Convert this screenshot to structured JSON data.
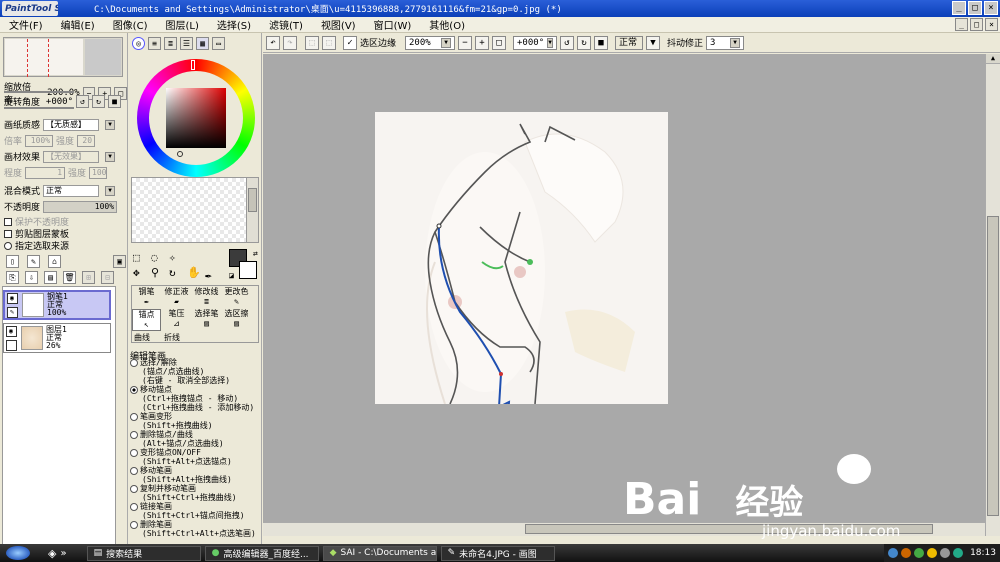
{
  "titlebar": {
    "logo": "PaintTool SAI",
    "title": "C:\\Documents and Settings\\Administrator\\桌面\\u=4115396888,2779161116&fm=21&gp=0.jpg (*)",
    "min": "_",
    "max": "□",
    "close": "×"
  },
  "menu": [
    "文件(F)",
    "编辑(E)",
    "图像(C)",
    "图层(L)",
    "选择(S)",
    "滤镜(T)",
    "视图(V)",
    "窗口(W)",
    "其他(O)"
  ],
  "navigator": {
    "zoom_label": "缩放倍率",
    "zoom_value": "200.0%",
    "rotate_label": "旋转角度",
    "rotate_value": "+000°"
  },
  "paper": {
    "texture_label": "画纸质感",
    "texture_value": "【无质感】",
    "rate_label": "倍率",
    "rate_value": "100%",
    "strength_label": "强度",
    "strength_value": "20",
    "effect_label": "画材效果",
    "effect_value": "【无效果】",
    "degree_label": "程度",
    "degree_value": "1",
    "strength2_label": "强度",
    "strength2_value": "100"
  },
  "layer_props": {
    "blend_label": "混合模式",
    "blend_value": "正常",
    "opacity_label": "不透明度",
    "opacity_value": "100%",
    "protect": "保护不透明度",
    "clip": "剪贴图层蒙板",
    "source": "指定选取来源"
  },
  "layers": [
    {
      "name": "钢笔1",
      "mode": "正常",
      "opacity": "100%"
    },
    {
      "name": "图层1",
      "mode": "正常",
      "opacity": "26%"
    }
  ],
  "tools": [
    {
      "label": "钢笔",
      "sub": ""
    },
    {
      "label": "修正液",
      "sub": ""
    },
    {
      "label": "修改线",
      "sub": ""
    },
    {
      "label": "更改色",
      "sub": ""
    },
    {
      "label": "锚点",
      "sub": "曲线"
    },
    {
      "label": "笔压",
      "sub": "折线"
    },
    {
      "label": "选择笔",
      "sub": ""
    },
    {
      "label": "选区擦",
      "sub": ""
    }
  ],
  "edit_options": {
    "header": "编辑笔画",
    "items": [
      {
        "label": "选择/解除",
        "hint": "(锚点/点选曲线)\n(右键 - 取消全部选择)",
        "on": false
      },
      {
        "label": "移动锚点",
        "hint": "(Ctrl+拖拽锚点 - 移动)\n(Ctrl+拖拽曲线 - 添加移动)",
        "on": true
      },
      {
        "label": "笔画变形",
        "hint": "(Shift+拖拽曲线)",
        "on": false
      },
      {
        "label": "删除锚点/曲线",
        "hint": "(Alt+锚点/点选曲线)",
        "on": false
      },
      {
        "label": "变形锚点ON/OFF",
        "hint": "(Shift+Alt+点选锚点)",
        "on": false
      },
      {
        "label": "移动笔画",
        "hint": "(Shift+Alt+拖拽曲线)",
        "on": false
      },
      {
        "label": "复制并移动笔画",
        "hint": "(Shift+Ctrl+拖拽曲线)",
        "on": false
      },
      {
        "label": "链接笔画",
        "hint": "(Shift+Ctrl+锚点间拖拽)",
        "on": false
      },
      {
        "label": "删除笔画",
        "hint": "(Shift+Ctrl+Alt+点选笔画)",
        "on": false
      }
    ]
  },
  "toolbar": {
    "selection_edge": "选区边缘",
    "zoom": "200%",
    "rotate": "+000°",
    "mode": "正常",
    "stabilizer_label": "抖动修正",
    "stabilizer_value": "3"
  },
  "taskbar": {
    "tasks": [
      "搜索结果",
      "高级编辑器_百度经...",
      "SAI - C:\\Documents a...",
      "未命名4.JPG - 画图"
    ],
    "clock": "18:13"
  },
  "watermark": {
    "brand": "Bai",
    "brand2": "经验",
    "url": "jingyan.baidu.com"
  },
  "colors": {
    "title": "#0b3fb8",
    "canvas_bg": "#a9a9a9",
    "stroke": "#1f4fb0",
    "primary": "#3b3b3b"
  }
}
